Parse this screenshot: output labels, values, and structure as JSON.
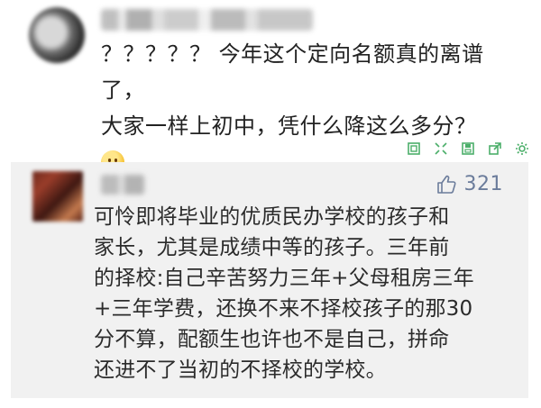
{
  "post": {
    "text_line1": "？？？？？ 今年这个定向名额真的离谱了，",
    "text_line2": "大家一样上初中，凭什么降这么多分？"
  },
  "toolbar": {
    "icons": [
      "frame-icon",
      "expand-icon",
      "save-icon",
      "share-icon",
      "settings-icon"
    ]
  },
  "reply": {
    "likes_count": "321",
    "lines": [
      "可怜即将毕业的优质民办学校的孩子和",
      "家长，尤其是成绩中等的孩子。三年前",
      "的择校:自己辛苦努力三年+父母租房三年",
      "+三年学费，还换不来不择校孩子的那30",
      "分不算，配额生也许也不是自己，拼命",
      "还进不了当初的不择校的学校。"
    ]
  },
  "colors": {
    "accent": "#6b7c9b",
    "toolbar_green": "#4caf6a",
    "reply_bg": "#f1f1f1"
  }
}
